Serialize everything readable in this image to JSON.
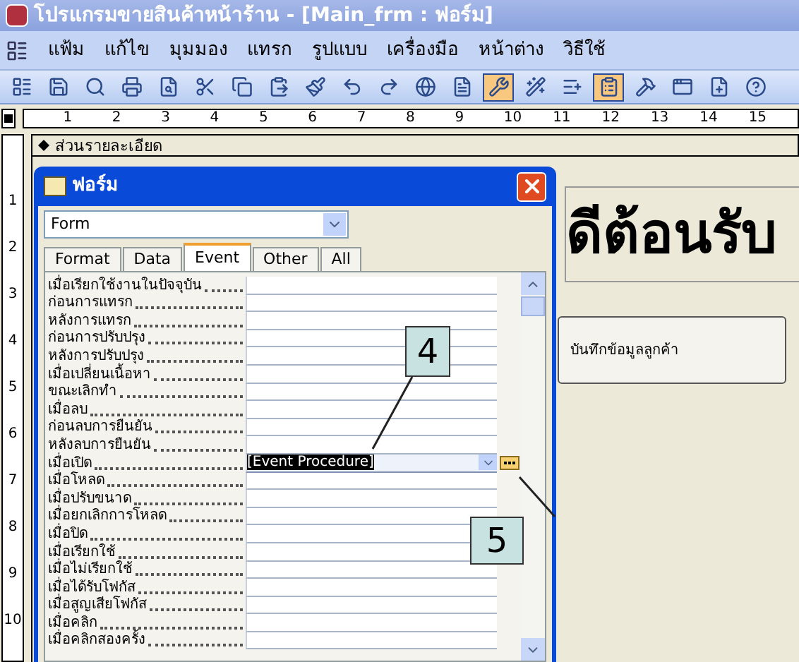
{
  "window": {
    "title": "โปรแกรมขายสินค้าหน้าร้าน - [Main_frm : ฟอร์ม]"
  },
  "menu": [
    "แฟ้ม",
    "แก้ไข",
    "มุมมอง",
    "แทรก",
    "รูปแบบ",
    "เครื่องมือ",
    "หน้าต่าง",
    "วิธีใช้"
  ],
  "toolbar": [
    {
      "kind": "view",
      "pressed": false
    },
    {
      "kind": "save",
      "pressed": false
    },
    {
      "kind": "search",
      "pressed": false
    },
    {
      "kind": "print",
      "pressed": false
    },
    {
      "kind": "preview",
      "pressed": false
    },
    {
      "kind": "cut",
      "pressed": false
    },
    {
      "kind": "copy",
      "pressed": false
    },
    {
      "kind": "paste",
      "pressed": false
    },
    {
      "kind": "brush",
      "pressed": false
    },
    {
      "kind": "undo",
      "pressed": false
    },
    {
      "kind": "redo",
      "pressed": false
    },
    {
      "kind": "link",
      "pressed": false
    },
    {
      "kind": "list",
      "pressed": false
    },
    {
      "kind": "tools",
      "pressed": true
    },
    {
      "kind": "wand",
      "pressed": false
    },
    {
      "kind": "field",
      "pressed": false
    },
    {
      "kind": "properties",
      "pressed": true
    },
    {
      "kind": "build",
      "pressed": false
    },
    {
      "kind": "window",
      "pressed": false
    },
    {
      "kind": "new",
      "pressed": false
    },
    {
      "kind": "help",
      "pressed": false
    }
  ],
  "ruler": {
    "marks": [
      "1",
      "2",
      "3",
      "4",
      "5",
      "6",
      "7",
      "8",
      "9",
      "10",
      "11",
      "12",
      "13",
      "14",
      "15"
    ]
  },
  "vertical_ruler": {
    "marks": [
      "1",
      "2",
      "3",
      "4",
      "5",
      "6",
      "7",
      "8",
      "9",
      "10"
    ]
  },
  "section": {
    "title": "ส่วนรายละเอียด"
  },
  "form_canvas": {
    "heading": "ดีต้อนรับ",
    "button": "บันทึกข้อมูลลูกค้า"
  },
  "property_sheet": {
    "title": "ฟอร์ม",
    "object": "Form",
    "tabs": [
      {
        "label": "Format",
        "selected": false
      },
      {
        "label": "Data",
        "selected": false
      },
      {
        "label": "Event",
        "selected": true
      },
      {
        "label": "Other",
        "selected": false
      },
      {
        "label": "All",
        "selected": false
      }
    ],
    "properties": [
      {
        "label": "เมื่อเรียกใช้งานในปัจจุบัน",
        "selected": false
      },
      {
        "label": "ก่อนการแทรก",
        "selected": false
      },
      {
        "label": "หลังการแทรก",
        "selected": false
      },
      {
        "label": "ก่อนการปรับปรุง",
        "selected": false
      },
      {
        "label": "หลังการปรับปรุง",
        "selected": false
      },
      {
        "label": "เมื่อเปลี่ยนเนื้อหา",
        "selected": false
      },
      {
        "label": "ขณะเลิกทำ",
        "selected": false
      },
      {
        "label": "เมื่อลบ",
        "selected": false
      },
      {
        "label": "ก่อนลบการยืนยัน",
        "selected": false
      },
      {
        "label": "หลังลบการยืนยัน",
        "selected": false
      },
      {
        "label": "เมื่อเปิด",
        "value": "[Event Procedure]",
        "selected": true
      },
      {
        "label": "เมื่อโหลด",
        "selected": false
      },
      {
        "label": "เมื่อปรับขนาด",
        "selected": false
      },
      {
        "label": "เมื่อยกเลิกการโหลด",
        "selected": false
      },
      {
        "label": "เมื่อปิด",
        "selected": false
      },
      {
        "label": "เมื่อเรียกใช้",
        "selected": false
      },
      {
        "label": "เมื่อไม่เรียกใช้",
        "selected": false
      },
      {
        "label": "เมื่อได้รับโฟกัส",
        "selected": false
      },
      {
        "label": "เมื่อสูญเสียโฟกัส",
        "selected": false
      },
      {
        "label": "เมื่อคลิก",
        "selected": false
      },
      {
        "label": "เมื่อคลิกสองครั้ง",
        "selected": false
      }
    ]
  },
  "callouts": [
    {
      "label": "4"
    },
    {
      "label": "5"
    }
  ]
}
